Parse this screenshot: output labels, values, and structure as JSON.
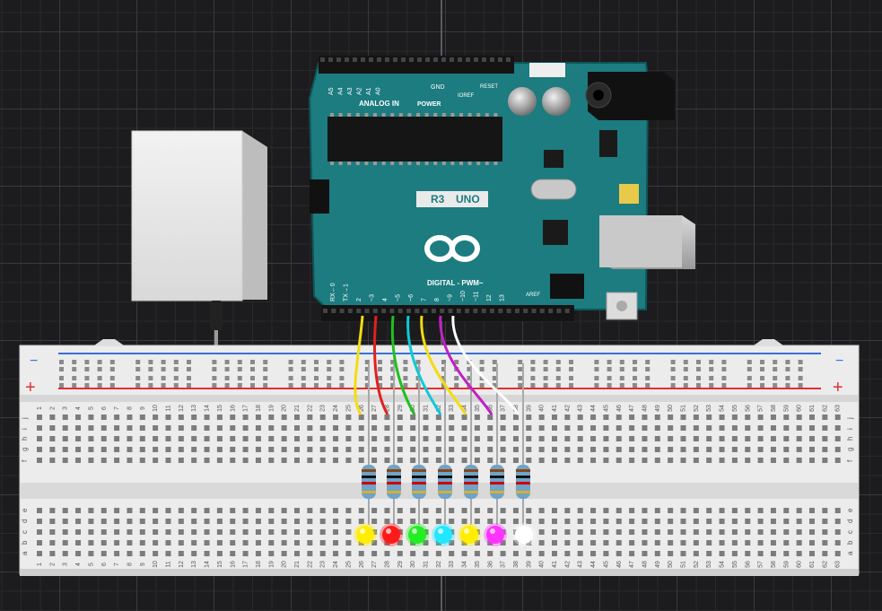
{
  "colors": {
    "background": "#1c1c1e",
    "board": "#1c7c7f",
    "breadboard": "#ededed",
    "rail_negative": "#3a6fd8",
    "rail_positive": "#e03030"
  },
  "arduino": {
    "model_label": "UNO",
    "revision_label": "R3",
    "analog_header": "ANALOG IN",
    "power_header": "POWER",
    "digital_header": "DIGITAL - PWM~",
    "gnd_label": "GND",
    "aref_label": "AREF",
    "reset_label": "RESET",
    "ioref_label": "IOREF",
    "analog_pins": [
      "A5",
      "A4",
      "A3",
      "A2",
      "A1",
      "A0"
    ],
    "digital_pins": [
      "RX←0",
      "TX→1",
      "2",
      "~3",
      "4",
      "~5",
      "~6",
      "7",
      "8",
      "~9",
      "~10",
      "~11",
      "12",
      "13"
    ]
  },
  "power_module": {
    "icon": "power-supply-box"
  },
  "breadboard": {
    "rail_minus_symbol": "−",
    "rail_plus_symbol": "+",
    "columns_start": 1,
    "columns_end": 63,
    "top_row_letters": [
      "j",
      "i",
      "h",
      "g",
      "f"
    ],
    "bottom_row_letters": [
      "e",
      "d",
      "c",
      "b",
      "a"
    ]
  },
  "circuit": {
    "wires": [
      {
        "pin": "~3",
        "color": "#f4dc10"
      },
      {
        "pin": "4",
        "color": "#e02020"
      },
      {
        "pin": "~5",
        "color": "#20c020"
      },
      {
        "pin": "~6",
        "color": "#10c8d8"
      },
      {
        "pin": "7",
        "color": "#f4dc10"
      },
      {
        "pin": "8",
        "color": "#c020c8"
      },
      {
        "pin": "~9",
        "color": "#ffffff"
      }
    ],
    "leds": [
      {
        "column": 27,
        "color": "#ffee00"
      },
      {
        "column": 28,
        "color": "#ff1a1a"
      },
      {
        "column": 30,
        "color": "#22ee22"
      },
      {
        "column": 32,
        "color": "#22e8ff"
      },
      {
        "column": 34,
        "color": "#ffee00"
      },
      {
        "column": 36,
        "color": "#ff33ff"
      },
      {
        "column": 38,
        "color": "#ffffff"
      }
    ],
    "resistor_count": 7
  }
}
